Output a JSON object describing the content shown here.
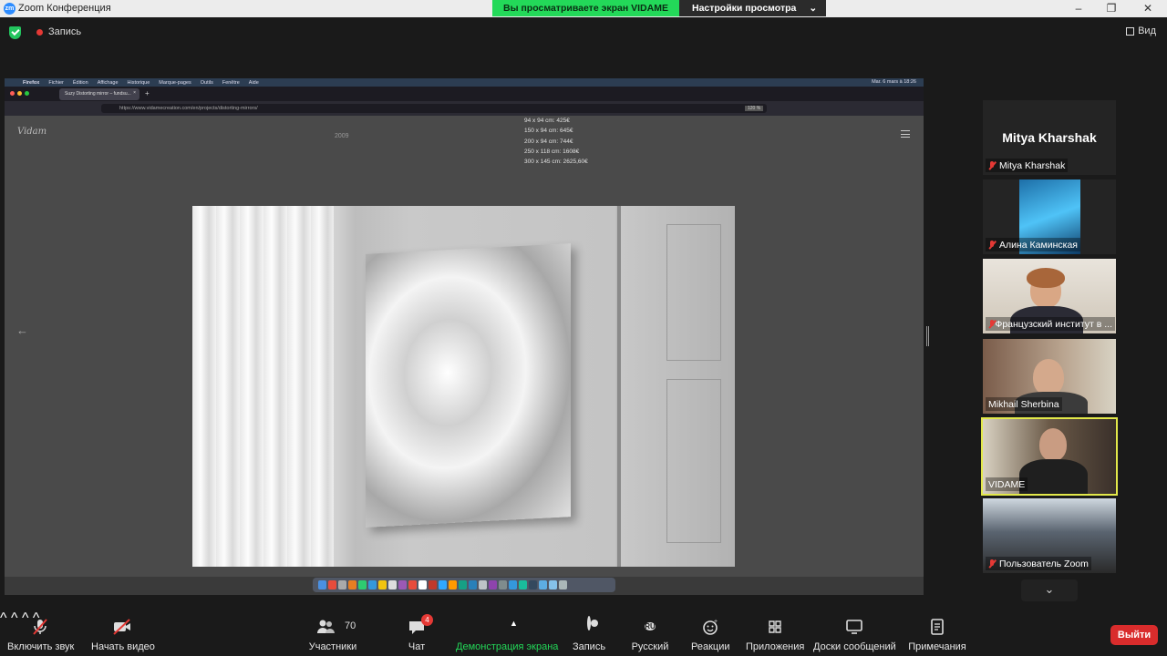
{
  "window": {
    "app_icon": "zm",
    "title": "Zoom Конференция",
    "share_banner": "Вы просматриваете экран VIDAME",
    "view_settings": "Настройки просмотра",
    "view_settings_caret": "⌄",
    "minimize": "–",
    "maximize": "❐",
    "close": "✕"
  },
  "topbar": {
    "recording_label": "Запись",
    "view_label": "Вид"
  },
  "shared_screen": {
    "mac_menu": [
      "Firefox",
      "Fichier",
      "Édition",
      "Affichage",
      "Historique",
      "Marque-pages",
      "Outils",
      "Fenêtre",
      "Aide"
    ],
    "mac_clock": "Mar. 6 mars à 18:26",
    "tab_title": "Suzy Distorting mirror – fundsu...",
    "tab_close": "×",
    "new_tab": "+",
    "url": "https://www.vidamecreation.com/en/projects/distorting-mirrors/",
    "zoom": "120 %",
    "logo": "Vidam",
    "year": "2009",
    "prices": [
      "94 x 94 cm: 425€",
      "150 x 94 cm: 645€",
      "200 x 94 cm: 744€",
      "250 x 118 cm: 1608€",
      "300 x 145 cm: 2625,60€"
    ],
    "prev_arrow": "←"
  },
  "participants": [
    {
      "name": "Mitya Kharshak",
      "big_name": "Mitya Kharshak",
      "muted": true
    },
    {
      "name": "Алина Каминская",
      "muted": true
    },
    {
      "name": "Французский институт в ...",
      "muted": true
    },
    {
      "name": "Mikhail Sherbina",
      "muted": false
    },
    {
      "name": "VIDAME",
      "muted": false,
      "active_speaker": true
    },
    {
      "name": "Пользователь Zoom",
      "muted": true
    }
  ],
  "more_participants": "⌄",
  "toolbar": {
    "unmute": "Включить звук",
    "start_video": "Начать видео",
    "participants": "Участники",
    "participants_count": "70",
    "chat": "Чат",
    "chat_badge": "4",
    "share_screen": "Демонстрация экрана",
    "record": "Запись",
    "language_code": "RU",
    "language": "Русский",
    "reactions": "Реакции",
    "apps": "Приложения",
    "whiteboards": "Доски сообщений",
    "notes": "Примечания",
    "leave": "Выйти",
    "caret": "^"
  },
  "colors": {
    "share_green": "#23d959",
    "leave_red": "#d92c2c",
    "active_speaker_border": "#e2e84a",
    "muted_red": "#e53935"
  }
}
